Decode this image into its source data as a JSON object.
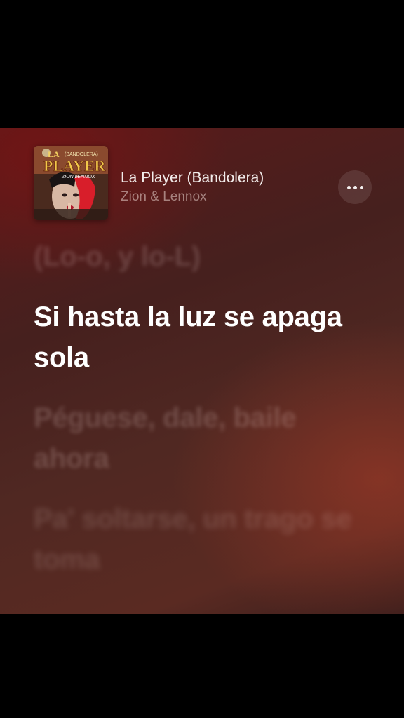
{
  "now_playing": {
    "title": "La Player (Bandolera)",
    "artist": "Zion & Lennox",
    "artwork_text_top": "(BANDOLERA)",
    "artwork_text_main": "LA PLAYER",
    "artwork_text_artists": "ZION LENNOX"
  },
  "more_button": {
    "icon": "ellipsis-icon"
  },
  "lyrics": {
    "previous": "(Lo-o, y lo-L)",
    "current": "Si hasta la luz se apaga sola",
    "next": "Péguese, dale, baile ahora",
    "after_next": "Pa' soltarse, un trago se toma"
  },
  "colors": {
    "background_top": "#5a1a1a",
    "background_bottom": "#5a2a22",
    "active_lyric": "#ffffff"
  }
}
